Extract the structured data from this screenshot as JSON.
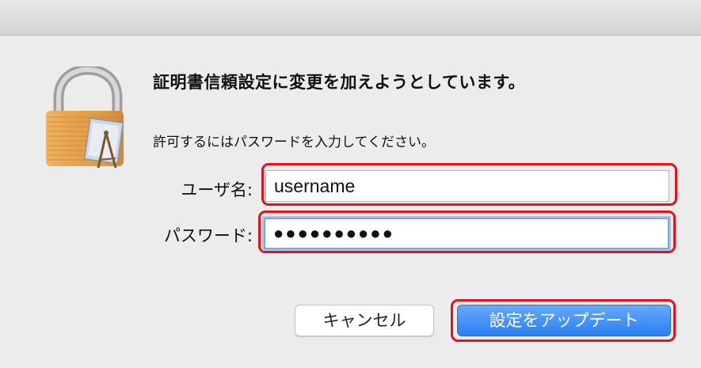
{
  "dialog": {
    "heading": "証明書信頼設定に変更を加えようとしています。",
    "prompt": "許可するにはパスワードを入力してください。"
  },
  "form": {
    "username_label": "ユーザ名:",
    "username_value": "username",
    "password_label": "パスワード:",
    "password_value": "●●●●●●●●●●"
  },
  "buttons": {
    "cancel_label": "キャンセル",
    "update_label": "設定をアップデート"
  },
  "icons": {
    "lock": "lock-with-certificate-icon"
  },
  "colors": {
    "default_button": "#2a7ff3",
    "highlight_outline": "#e0141e",
    "focus_ring": "#7da7db"
  }
}
